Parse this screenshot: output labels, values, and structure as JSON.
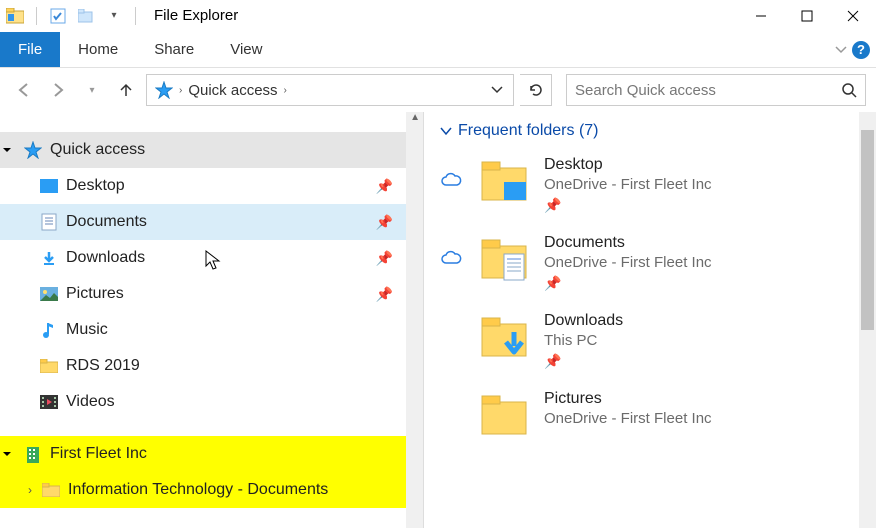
{
  "window": {
    "title": "File Explorer"
  },
  "ribbon": {
    "file": "File",
    "tabs": [
      "Home",
      "Share",
      "View"
    ]
  },
  "address": {
    "root": "Quick access"
  },
  "search": {
    "placeholder": "Search Quick access"
  },
  "tree": {
    "quick_access": {
      "label": "Quick access"
    },
    "items": [
      {
        "label": "Desktop",
        "pinned": true
      },
      {
        "label": "Documents",
        "pinned": true
      },
      {
        "label": "Downloads",
        "pinned": true
      },
      {
        "label": "Pictures",
        "pinned": true
      },
      {
        "label": "Music",
        "pinned": false
      },
      {
        "label": "RDS 2019",
        "pinned": false
      },
      {
        "label": "Videos",
        "pinned": false
      }
    ],
    "company": {
      "label": "First Fleet Inc"
    },
    "company_child": {
      "label": "Information Technology - Documents"
    }
  },
  "content": {
    "section": {
      "label": "Frequent folders (7)"
    },
    "folders": [
      {
        "name": "Desktop",
        "location": "OneDrive - First Fleet Inc",
        "cloud": true,
        "overlay": "desktop"
      },
      {
        "name": "Documents",
        "location": "OneDrive - First Fleet Inc",
        "cloud": true,
        "overlay": "document"
      },
      {
        "name": "Downloads",
        "location": "This PC",
        "cloud": false,
        "overlay": "download"
      },
      {
        "name": "Pictures",
        "location": "OneDrive - First Fleet Inc",
        "cloud": false,
        "overlay": ""
      }
    ]
  }
}
